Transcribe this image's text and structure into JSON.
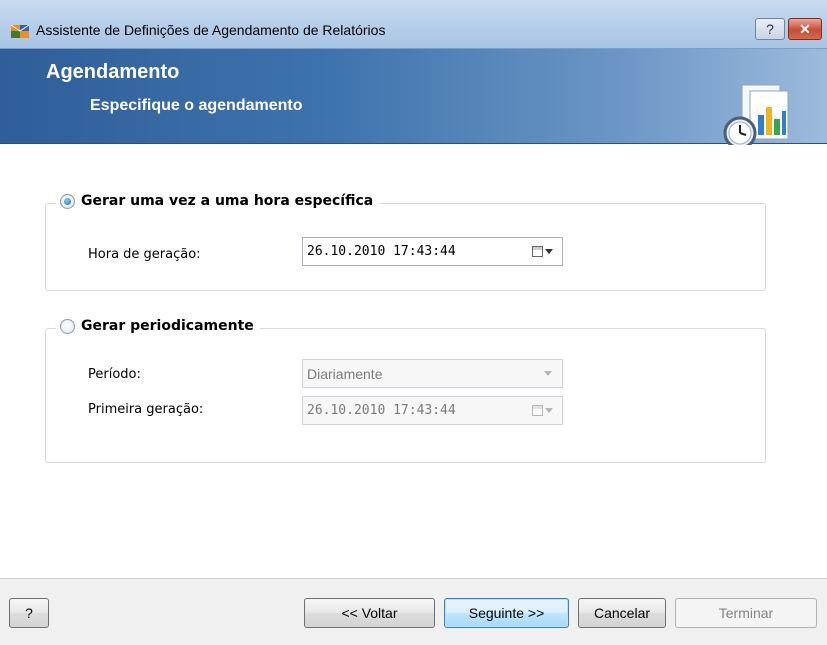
{
  "window": {
    "title": "Assistente de Definições de Agendamento de Relatórios",
    "help_label": "?",
    "close_label": "✕"
  },
  "banner": {
    "title": "Agendamento",
    "subtitle": "Especifique o agendamento"
  },
  "option_once": {
    "label": "Gerar uma vez a uma hora específica",
    "selected": true,
    "time_label": "Hora de geração:",
    "time_value": "26.10.2010 17:43:44"
  },
  "option_periodic": {
    "label": "Gerar periodicamente",
    "selected": false,
    "period_label": "Período:",
    "period_value": "Diariamente",
    "first_label": "Primeira geração:",
    "first_value": "26.10.2010 17:43:44"
  },
  "buttons": {
    "help": "?",
    "back": "<< Voltar",
    "next": "Seguinte >>",
    "cancel": "Cancelar",
    "finish": "Terminar"
  },
  "colors": {
    "banner_dark": "#2f5e99",
    "banner_light": "#9dbbdc",
    "close_red": "#c74c35"
  },
  "icons": [
    "app-logo-icon",
    "report-clock-icon",
    "calendar-icon",
    "dropdown-arrow-icon"
  ]
}
